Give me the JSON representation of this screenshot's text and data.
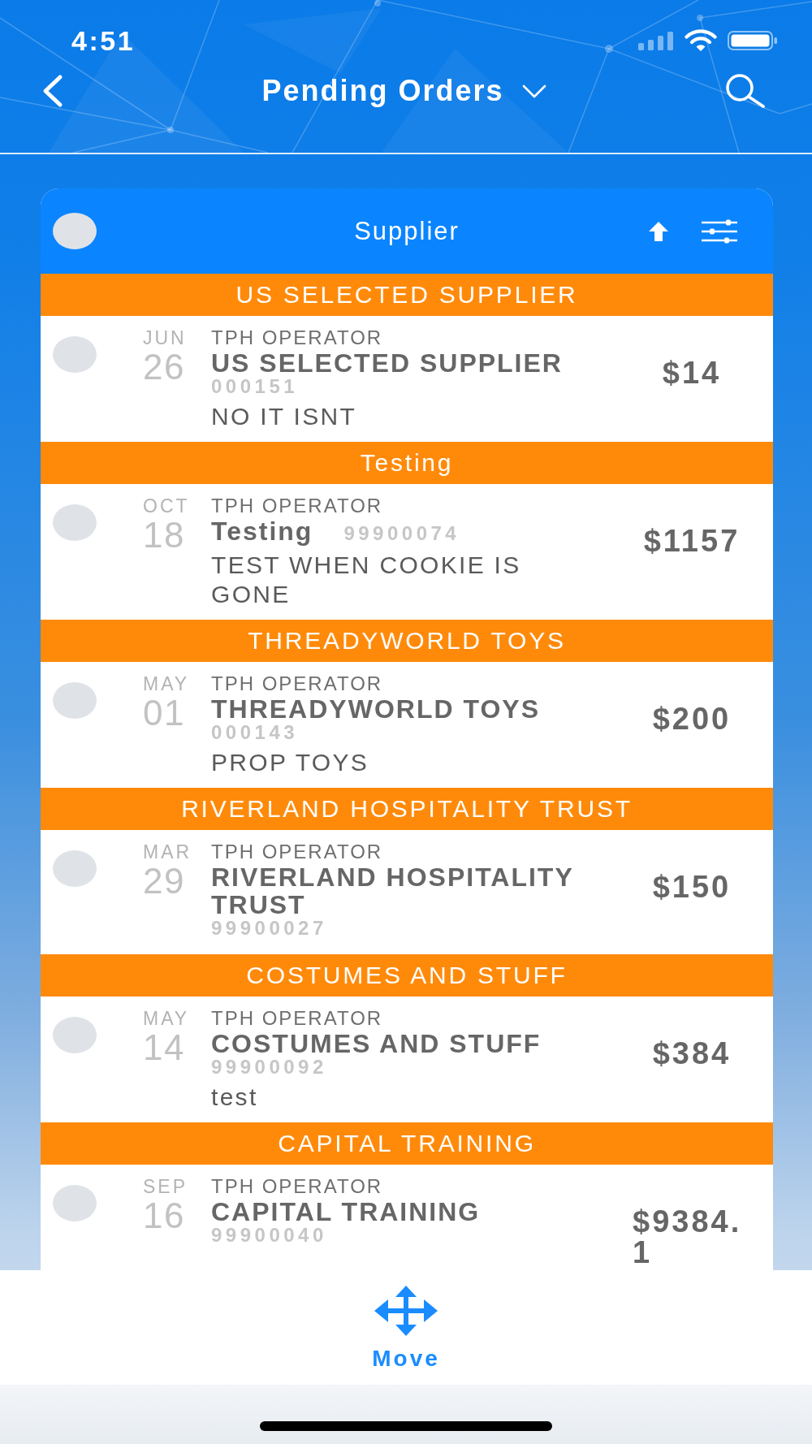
{
  "status_bar": {
    "time": "4:51"
  },
  "nav_bar": {
    "title": "Pending Orders"
  },
  "list_header": {
    "select_all": {
      "selected": false
    },
    "title": "Supplier"
  },
  "groups": [
    {
      "title": "US SELECTED SUPPLIER",
      "orders": [
        {
          "selected": false,
          "month": "JUN",
          "day": "26",
          "operator": "TPH OPERATOR",
          "supplier": "US SELECTED SUPPLIER",
          "number": "000151",
          "description": "NO IT ISNT",
          "amount": "$14"
        }
      ]
    },
    {
      "title": "Testing",
      "orders": [
        {
          "selected": false,
          "month": "OCT",
          "day": "18",
          "operator": "TPH OPERATOR",
          "supplier": "Testing",
          "number": "99900074",
          "description": "TEST WHEN COOKIE IS GONE",
          "amount": "$1157"
        }
      ]
    },
    {
      "title": "THREADYWORLD TOYS",
      "orders": [
        {
          "selected": false,
          "month": "MAY",
          "day": "01",
          "operator": "TPH OPERATOR",
          "supplier": "THREADYWORLD TOYS",
          "number": "000143",
          "description": "PROP TOYS",
          "amount": "$200"
        }
      ]
    },
    {
      "title": "RIVERLAND HOSPITALITY TRUST",
      "orders": [
        {
          "selected": false,
          "month": "MAR",
          "day": "29",
          "operator": "TPH OPERATOR",
          "supplier": "RIVERLAND HOSPITALITY TRUST",
          "number": "99900027",
          "amount": "$150"
        }
      ]
    },
    {
      "title": "COSTUMES AND STUFF",
      "orders": [
        {
          "selected": false,
          "month": "MAY",
          "day": "14",
          "operator": "TPH OPERATOR",
          "supplier": "COSTUMES AND STUFF",
          "number": "99900092",
          "description": "test",
          "amount": "$384"
        }
      ]
    },
    {
      "title": "CAPITAL TRAINING",
      "orders": [
        {
          "selected": false,
          "month": "SEP",
          "day": "16",
          "operator": "TPH OPERATOR",
          "supplier": "CAPITAL TRAINING",
          "number": "99900040",
          "amount": "$9384.1"
        }
      ]
    }
  ],
  "toolbar": {
    "actions": [
      {
        "kind": "move",
        "label": "Move"
      }
    ]
  }
}
